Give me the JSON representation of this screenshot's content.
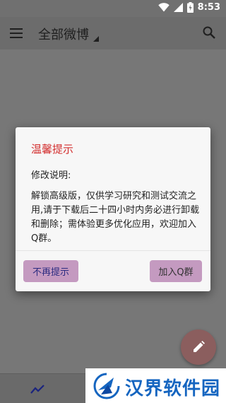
{
  "status_bar": {
    "time": "8:53",
    "icons": [
      "wifi-icon",
      "signal-icon",
      "battery-icon"
    ]
  },
  "app_bar": {
    "title": "全部微博",
    "icons": [
      "menu-icon",
      "caret-down-icon",
      "search-icon"
    ]
  },
  "dialog": {
    "title": "温馨提示",
    "subtitle": "修改说明:",
    "body": "解锁高级版，仅供学习研究和测试交流之用,请于下载后二十四小时内务必进行卸载和删除；需体验更多优化应用，欢迎加入Q群。",
    "button_left": "不再提示",
    "button_right": "加入Q群"
  },
  "bottom_nav": {
    "icons": [
      "trend-icon"
    ]
  },
  "fab": {
    "icon": "edit-icon"
  },
  "watermark": {
    "text": "汉界软件园"
  },
  "colors": {
    "dialog_title": "#d32f2f",
    "button_bg": "#c49ac0",
    "fab_bg": "#8b5e5e",
    "watermark_text": "#1565c0"
  }
}
